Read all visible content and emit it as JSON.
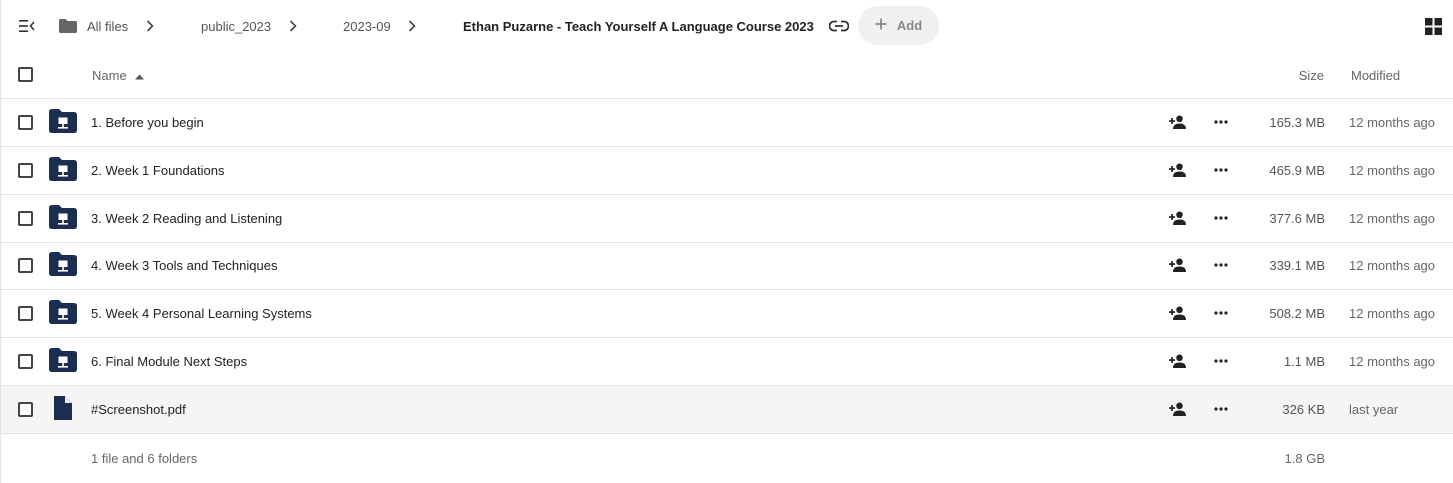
{
  "breadcrumb": {
    "home_label": "All files",
    "items": [
      "public_2023",
      "2023-09"
    ],
    "current": "Ethan Puzarne - Teach Yourself A Language Course 2023",
    "add_label": "Add"
  },
  "table": {
    "headers": {
      "name": "Name",
      "size": "Size",
      "modified": "Modified"
    },
    "sort": {
      "column": "name",
      "direction": "ascending"
    },
    "rows": [
      {
        "name": "1. Before you begin",
        "type": "folder",
        "size": "165.3 MB",
        "modified": "12 months ago"
      },
      {
        "name": "2. Week 1 Foundations",
        "type": "folder",
        "size": "465.9 MB",
        "modified": "12 months ago"
      },
      {
        "name": "3. Week 2 Reading and Listening",
        "type": "folder",
        "size": "377.6 MB",
        "modified": "12 months ago"
      },
      {
        "name": "4. Week 3 Tools and Techniques",
        "type": "folder",
        "size": "339.1 MB",
        "modified": "12 months ago"
      },
      {
        "name": "5. Week 4 Personal Learning Systems",
        "type": "folder",
        "size": "508.2 MB",
        "modified": "12 months ago"
      },
      {
        "name": "6. Final Module Next Steps",
        "type": "folder",
        "size": "1.1 MB",
        "modified": "12 months ago"
      },
      {
        "name": "#Screenshot.pdf",
        "type": "file",
        "size": "326 KB",
        "modified": "last year"
      }
    ],
    "footer": {
      "summary": "1 file and 6 folders",
      "total_size": "1.8 GB"
    }
  },
  "icons": {
    "nav_toggle": "menu-collapse-icon",
    "home": "folder-icon",
    "separator": "chevron-right-icon",
    "link": "link-icon",
    "add": "plus-icon",
    "view": "grid-view-icon",
    "sort": "sort-ascending-icon",
    "folder_row": "shared-folder-icon",
    "file_row": "document-icon",
    "share": "person-add-icon",
    "more": "more-horizontal-icon"
  },
  "colors": {
    "folder": "#1c2e4f",
    "hover_row": "#f5f5f5",
    "border": "#e4e4e4",
    "add_button_bg": "#f0f0f0"
  }
}
